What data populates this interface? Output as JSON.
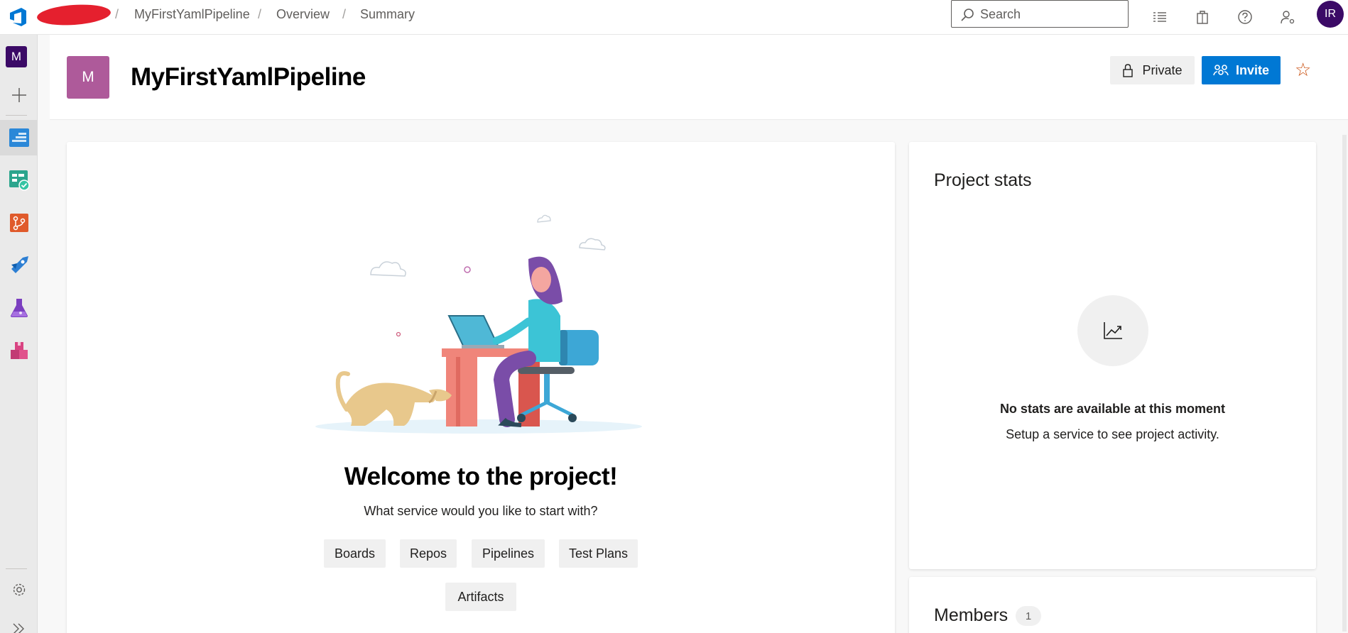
{
  "breadcrumb": {
    "items": [
      "MyFirstYamlPipeline",
      "Overview",
      "Summary"
    ],
    "separator": "/"
  },
  "search": {
    "placeholder": "Search"
  },
  "top_icons": [
    "work-items-icon",
    "marketplace-icon",
    "help-icon",
    "user-settings-icon"
  ],
  "user": {
    "initials": "IR",
    "color": "#3b0a66"
  },
  "rail": {
    "project_initial": "M",
    "items": [
      "overview",
      "boards",
      "repos",
      "pipelines",
      "test-plans",
      "artifacts"
    ]
  },
  "project": {
    "initial": "M",
    "name": "MyFirstYamlPipeline",
    "tile_color": "#ae5a9a",
    "private_label": "Private",
    "invite_label": "Invite"
  },
  "welcome": {
    "title": "Welcome to the project!",
    "subtitle": "What service would you like to start with?",
    "services": [
      "Boards",
      "Repos",
      "Pipelines",
      "Test Plans",
      "Artifacts"
    ]
  },
  "stats": {
    "title": "Project stats",
    "empty_title": "No stats are available at this moment",
    "empty_subtitle": "Setup a service to see project activity."
  },
  "members": {
    "title": "Members",
    "count": "1"
  },
  "colors": {
    "accent": "#0078d4",
    "star": "#ca5010"
  }
}
